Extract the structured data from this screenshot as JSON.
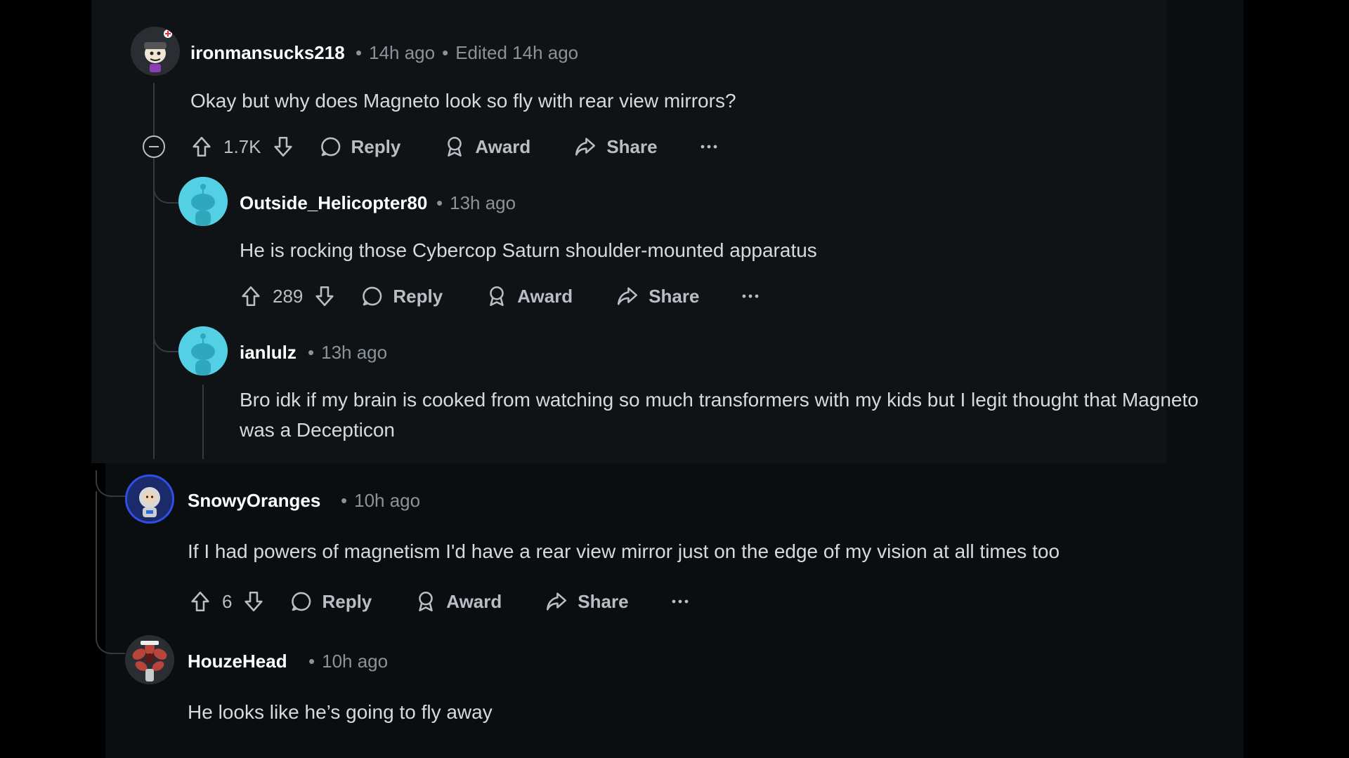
{
  "colors": {
    "background": "#000000",
    "panel": "#0b0e11",
    "text": "#d7dadc",
    "muted": "#8b9298",
    "snoo_cyan": "#54d0e5",
    "snowy_ring": "#2f4fe8"
  },
  "comments": [
    {
      "username": "ironmansucks218",
      "time": "14h ago",
      "edited": "Edited 14h ago",
      "body": "Okay but why does Magneto look so fly with rear view mirrors?",
      "score": "1.7K",
      "reply_label": "Reply",
      "award_label": "Award",
      "share_label": "Share",
      "avatar_icon": "custom-avatar-icon",
      "replies": [
        {
          "username": "Outside_Helicopter80",
          "time": "13h ago",
          "body": "He is rocking those Cybercop Saturn shoulder-mounted apparatus",
          "score": "289",
          "reply_label": "Reply",
          "award_label": "Award",
          "share_label": "Share",
          "avatar_icon": "snoo-avatar-icon"
        },
        {
          "username": "ianlulz",
          "time": "13h ago",
          "body": "Bro idk if my brain is cooked from watching so much transformers with my kids but I legit thought that Magneto was a Decepticon",
          "avatar_icon": "snoo-avatar-icon"
        }
      ]
    },
    {
      "username": "SnowyOranges",
      "time": "10h ago",
      "body": "If I had powers of magnetism I'd have a rear view mirror just on the edge of my vision at all times too",
      "score": "6",
      "reply_label": "Reply",
      "award_label": "Award",
      "share_label": "Share",
      "avatar_icon": "astronaut-avatar-icon"
    },
    {
      "username": "HouzeHead",
      "time": "10h ago",
      "body": "He looks like he’s going to fly away",
      "avatar_icon": "demogorgon-avatar-icon"
    }
  ]
}
